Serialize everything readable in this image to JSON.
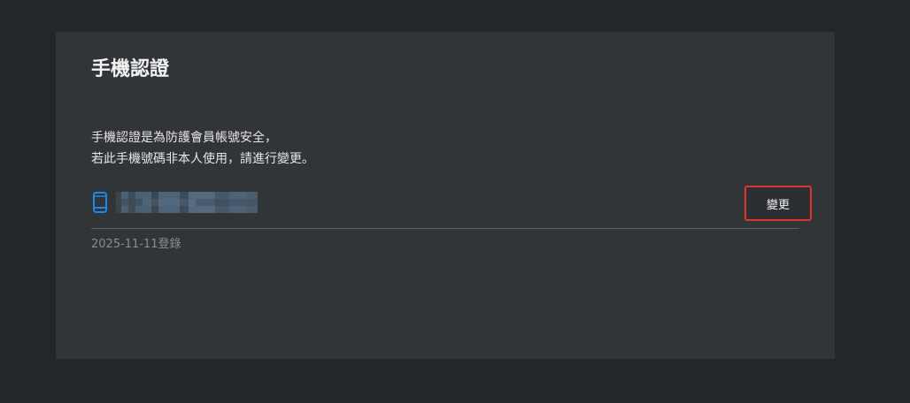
{
  "section": {
    "title": "手機認證",
    "description_lines": [
      "手機認證是為防護會員帳號安全，",
      "若此手機號碼非本人使用，請進行變更。"
    ]
  },
  "phone": {
    "icon": "smartphone-icon",
    "icon_color": "#1e88e5",
    "number_masked": "0912345678",
    "change_button_label": "變更",
    "change_button_outline_color": "#e0352e"
  },
  "registration": {
    "date_text": "2025-11-11登錄"
  }
}
